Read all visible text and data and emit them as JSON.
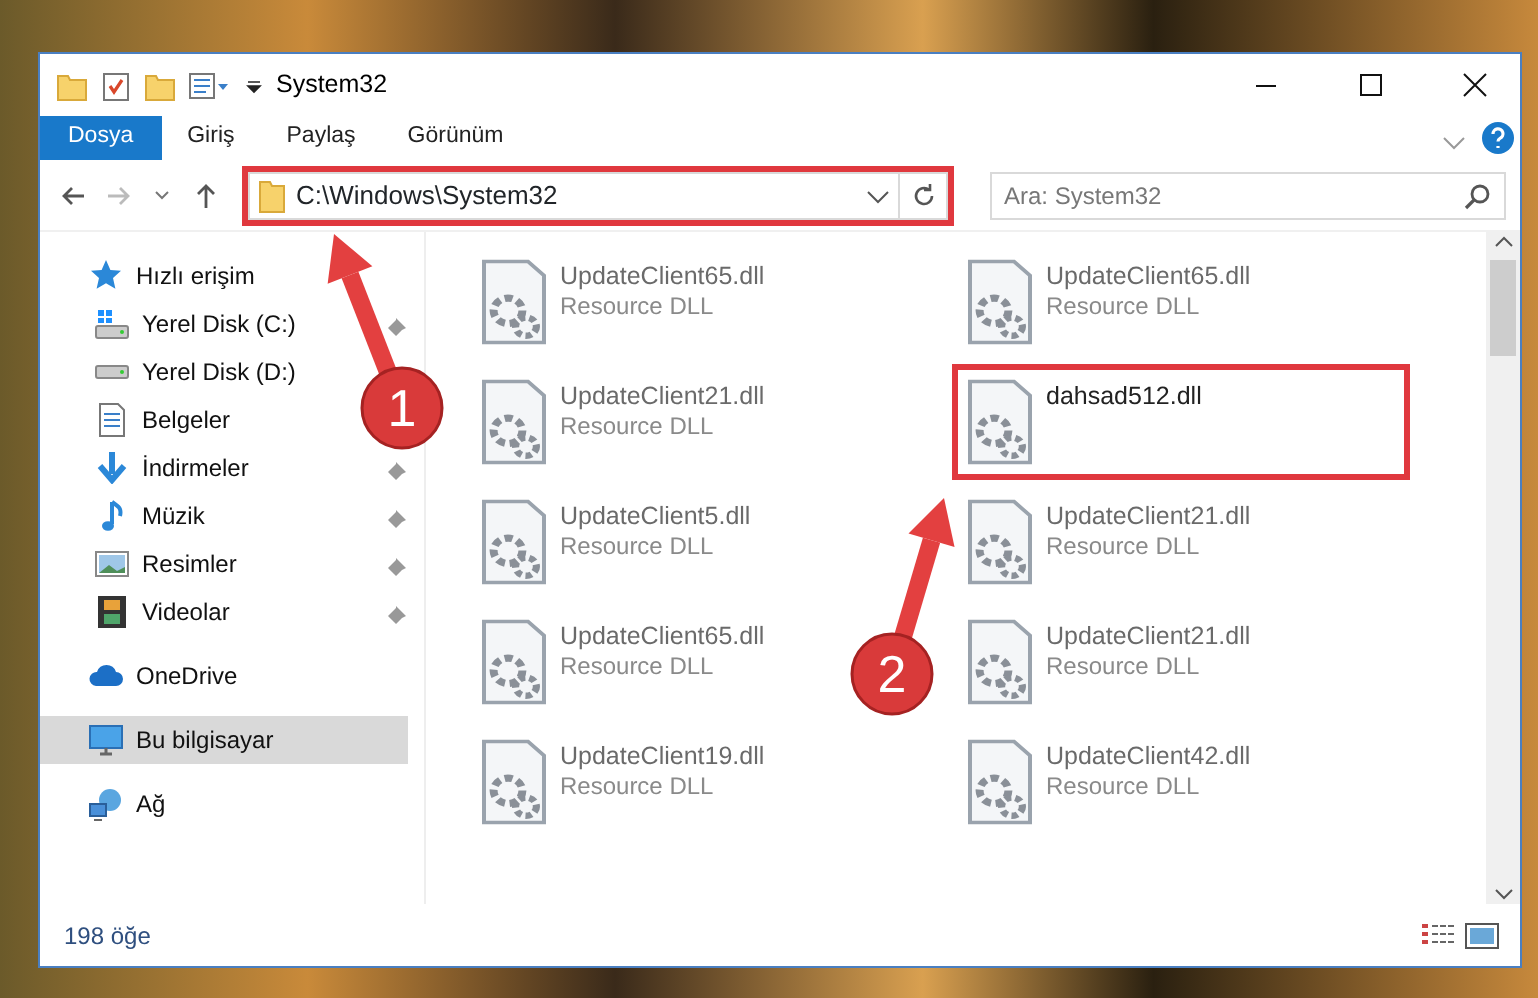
{
  "window": {
    "title": "System32"
  },
  "ribbon_tabs": [
    {
      "label": "Dosya",
      "kind": "file"
    },
    {
      "label": "Giriş",
      "kind": "tab"
    },
    {
      "label": "Paylaş",
      "kind": "tab"
    },
    {
      "label": "Görünüm",
      "kind": "tab"
    }
  ],
  "address": {
    "path": "C:\\Windows\\System32",
    "highlighted": true
  },
  "search": {
    "placeholder": "Ara: System32"
  },
  "sidebar": {
    "items": [
      {
        "label": "Hızlı erişim",
        "selected": false,
        "children": [
          {
            "label": "Yerel Disk (C:)",
            "pinned": true,
            "selected": false
          },
          {
            "label": "Yerel Disk (D:)",
            "pinned": false,
            "selected": false
          },
          {
            "label": "Belgeler",
            "pinned": false,
            "selected": false
          },
          {
            "label": "İndirmeler",
            "pinned": true,
            "selected": false
          },
          {
            "label": "Müzik",
            "pinned": true,
            "selected": false
          },
          {
            "label": "Resimler",
            "pinned": true,
            "selected": false
          },
          {
            "label": "Videolar",
            "pinned": true,
            "selected": false
          }
        ]
      },
      {
        "label": "OneDrive",
        "selected": false
      },
      {
        "label": "Bu bilgisayar",
        "selected": true
      },
      {
        "label": "Ağ",
        "selected": false
      }
    ]
  },
  "files": [
    {
      "name": "UpdateClient65.dll",
      "type": "Resource DLL",
      "blurred": true,
      "highlighted": false
    },
    {
      "name": "UpdateClient65.dll",
      "type": "Resource DLL",
      "blurred": true,
      "highlighted": false
    },
    {
      "name": "UpdateClient21.dll",
      "type": "Resource DLL",
      "blurred": true,
      "highlighted": false
    },
    {
      "name": "dahsad512.dll",
      "blurred": false,
      "highlighted": true
    },
    {
      "name": "UpdateClient5.dll",
      "type": "Resource DLL",
      "blurred": true,
      "highlighted": false
    },
    {
      "name": "UpdateClient21.dll",
      "type": "Resource DLL",
      "blurred": true,
      "highlighted": false
    },
    {
      "name": "UpdateClient65.dll",
      "type": "Resource DLL",
      "blurred": true,
      "highlighted": false
    },
    {
      "name": "UpdateClient21.dll",
      "type": "Resource DLL",
      "blurred": true,
      "highlighted": false
    },
    {
      "name": "UpdateClient19.dll",
      "type": "Resource DLL",
      "blurred": true,
      "highlighted": false
    },
    {
      "name": "UpdateClient42.dll",
      "type": "Resource DLL",
      "blurred": true,
      "highlighted": false
    }
  ],
  "status_bar": {
    "item_count": "198 öğe"
  },
  "annotations": [
    {
      "label": "1"
    },
    {
      "label": "2"
    }
  ]
}
